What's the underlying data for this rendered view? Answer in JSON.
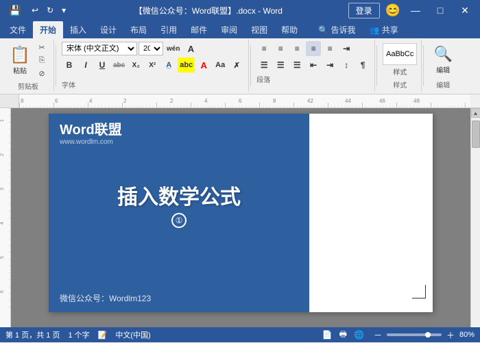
{
  "titlebar": {
    "title": "【微信公众号：Word联盟】.docx - Word",
    "save_label": "💾",
    "undo_label": "↩",
    "redo_label": "↻",
    "login_label": "登录",
    "min_label": "—",
    "max_label": "□",
    "close_label": "✕"
  },
  "tabs": [
    {
      "label": "文件",
      "active": false
    },
    {
      "label": "开始",
      "active": true
    },
    {
      "label": "插入",
      "active": false
    },
    {
      "label": "设计",
      "active": false
    },
    {
      "label": "布局",
      "active": false
    },
    {
      "label": "引用",
      "active": false
    },
    {
      "label": "邮件",
      "active": false
    },
    {
      "label": "审阅",
      "active": false
    },
    {
      "label": "视图",
      "active": false
    },
    {
      "label": "帮助",
      "active": false
    }
  ],
  "ribbon": {
    "clipboard_label": "剪贴板",
    "paste_label": "粘贴",
    "cut_label": "✂",
    "copy_label": "⎘",
    "format_paste_label": "⊘",
    "font_label": "字体",
    "font_name": "宋体 (中文正文)",
    "font_size": "20",
    "font_size_extra": "wén",
    "bold_label": "B",
    "italic_label": "I",
    "underline_label": "U",
    "strikethrough_label": "abc",
    "sub_label": "X₂",
    "sup_label": "X²",
    "highlight_label": "A",
    "font_color_label": "A",
    "para_label": "段落",
    "style_label": "样式",
    "edit_label": "编辑",
    "find_label": "查找",
    "tell_me": "告诉我",
    "share_label": "共享"
  },
  "banner": {
    "logo_name": "Word联盟",
    "logo_url": "www.wordlm.com",
    "title": "插入数学公式",
    "circle_num": "①",
    "subtitle": "微信公众号：Wordlm123"
  },
  "statusbar": {
    "page_info": "第 1 页，共 1 页",
    "word_count": "1 个字",
    "language": "中文(中国)",
    "zoom": "80%"
  }
}
